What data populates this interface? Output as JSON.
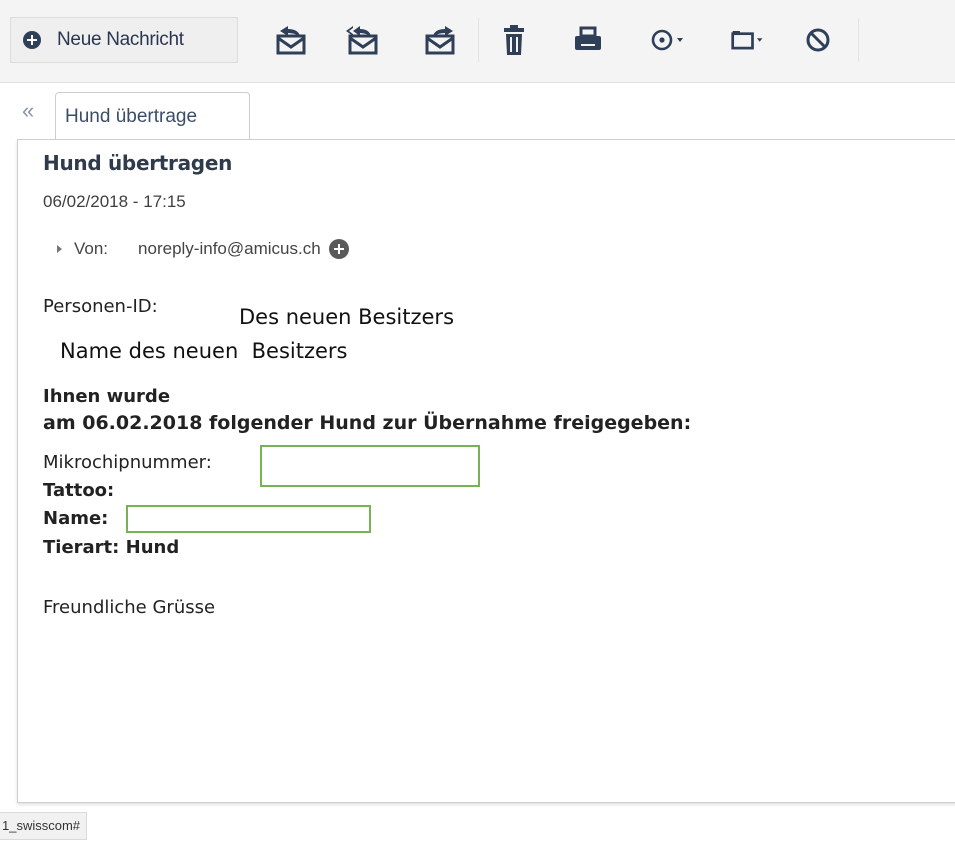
{
  "toolbar": {
    "new_message_label": "Neue Nachricht",
    "icons": [
      "reply-icon",
      "reply-all-icon",
      "forward-icon",
      "trash-icon",
      "print-icon",
      "more-options-icon",
      "move-to-folder-icon",
      "block-sender-icon"
    ]
  },
  "tabs": [
    {
      "label": "Hund übertrage"
    }
  ],
  "message": {
    "subject": "Hund übertragen",
    "datetime": "06/02/2018 - 17:15",
    "from_label": "Von:",
    "from_address": "noreply-info@amicus.ch",
    "person_id_label": "Personen-ID:",
    "annotation_owner_id": "Des neuen Besitzers",
    "annotation_owner_name": "Name des neuen  Besitzers",
    "line_1": "Ihnen wurde",
    "line_2": "am 06.02.2018 folgender Hund zur Übernahme freigegeben:",
    "microchip_label": "Mikrochipnummer:",
    "tattoo_label": "Tattoo:",
    "name_label": "Name:",
    "species_label": "Tierart:",
    "species_value": "Hund",
    "closing": "Freundliche Grüsse"
  },
  "status_bar": {
    "url_fragment": "1_swisscom#"
  },
  "colors": {
    "redaction_box": "#77b255",
    "toolbar_icon": "#2e3f57"
  }
}
